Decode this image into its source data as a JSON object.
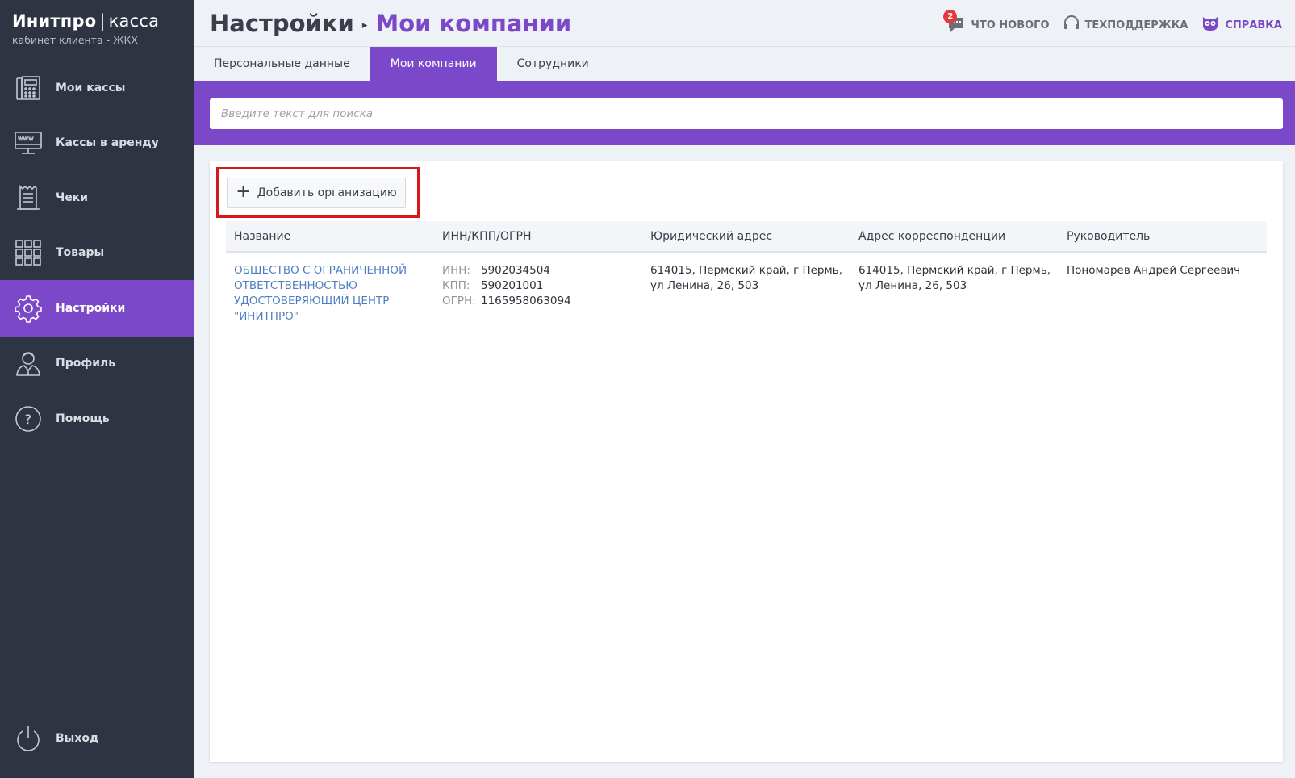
{
  "brand": {
    "name": "Инитпро",
    "separator": "|",
    "product": "касса",
    "subtitle": "кабинет клиента - ЖКХ"
  },
  "sidebar": {
    "items": [
      {
        "label": "Мои кассы",
        "icon": "cash-register-icon"
      },
      {
        "label": "Кассы в аренду",
        "icon": "www-monitor-icon"
      },
      {
        "label": "Чеки",
        "icon": "receipt-icon"
      },
      {
        "label": "Товары",
        "icon": "grid-icon"
      },
      {
        "label": "Настройки",
        "icon": "gear-icon",
        "active": true
      },
      {
        "label": "Профиль",
        "icon": "user-profile-icon"
      },
      {
        "label": "Помощь",
        "icon": "question-circle-icon"
      }
    ],
    "logout": {
      "label": "Выход",
      "icon": "power-icon"
    }
  },
  "header": {
    "breadcrumb_root": "Настройки",
    "breadcrumb_arrow": "▸",
    "breadcrumb_current": "Мои компании",
    "actions": {
      "news_label": "ЧТО НОВОГО",
      "news_badge": "2",
      "support_label": "ТЕХПОДДЕРЖКА",
      "help_label": "СПРАВКА"
    }
  },
  "tabs": [
    {
      "label": "Персональные данные"
    },
    {
      "label": "Мои компании",
      "active": true
    },
    {
      "label": "Сотрудники"
    }
  ],
  "search": {
    "placeholder": "Введите текст для поиска"
  },
  "content": {
    "add_button_icon": "+",
    "add_button_label": "Добавить организацию",
    "table": {
      "columns": [
        "Название",
        "ИНН/КПП/ОГРН",
        "Юридический адрес",
        "Адрес корреспонденции",
        "Руководитель"
      ],
      "rows": [
        {
          "name": "ОБЩЕСТВО С ОГРАНИЧЕННОЙ ОТВЕТСТВЕННОСТЬЮ УДОСТОВЕРЯЮЩИЙ ЦЕНТР \"ИНИТПРО\"",
          "inn_label": "ИНН:",
          "inn": "5902034504",
          "kpp_label": "КПП:",
          "kpp": "590201001",
          "ogrn_label": "ОГРН:",
          "ogrn": "1165958063094",
          "legal_address": "614015, Пермский край, г Пермь, ул Ленина, 26, 503",
          "mail_address": "614015, Пермский край, г Пермь, ул Ленина, 26, 503",
          "director": "Пономарев Андрей Сергеевич"
        }
      ]
    }
  },
  "colors": {
    "accent": "#7a48c8",
    "sidebar_bg": "#2f3443",
    "highlight": "#d7171c",
    "link": "#4f7fc1",
    "badge": "#e63a3a"
  }
}
